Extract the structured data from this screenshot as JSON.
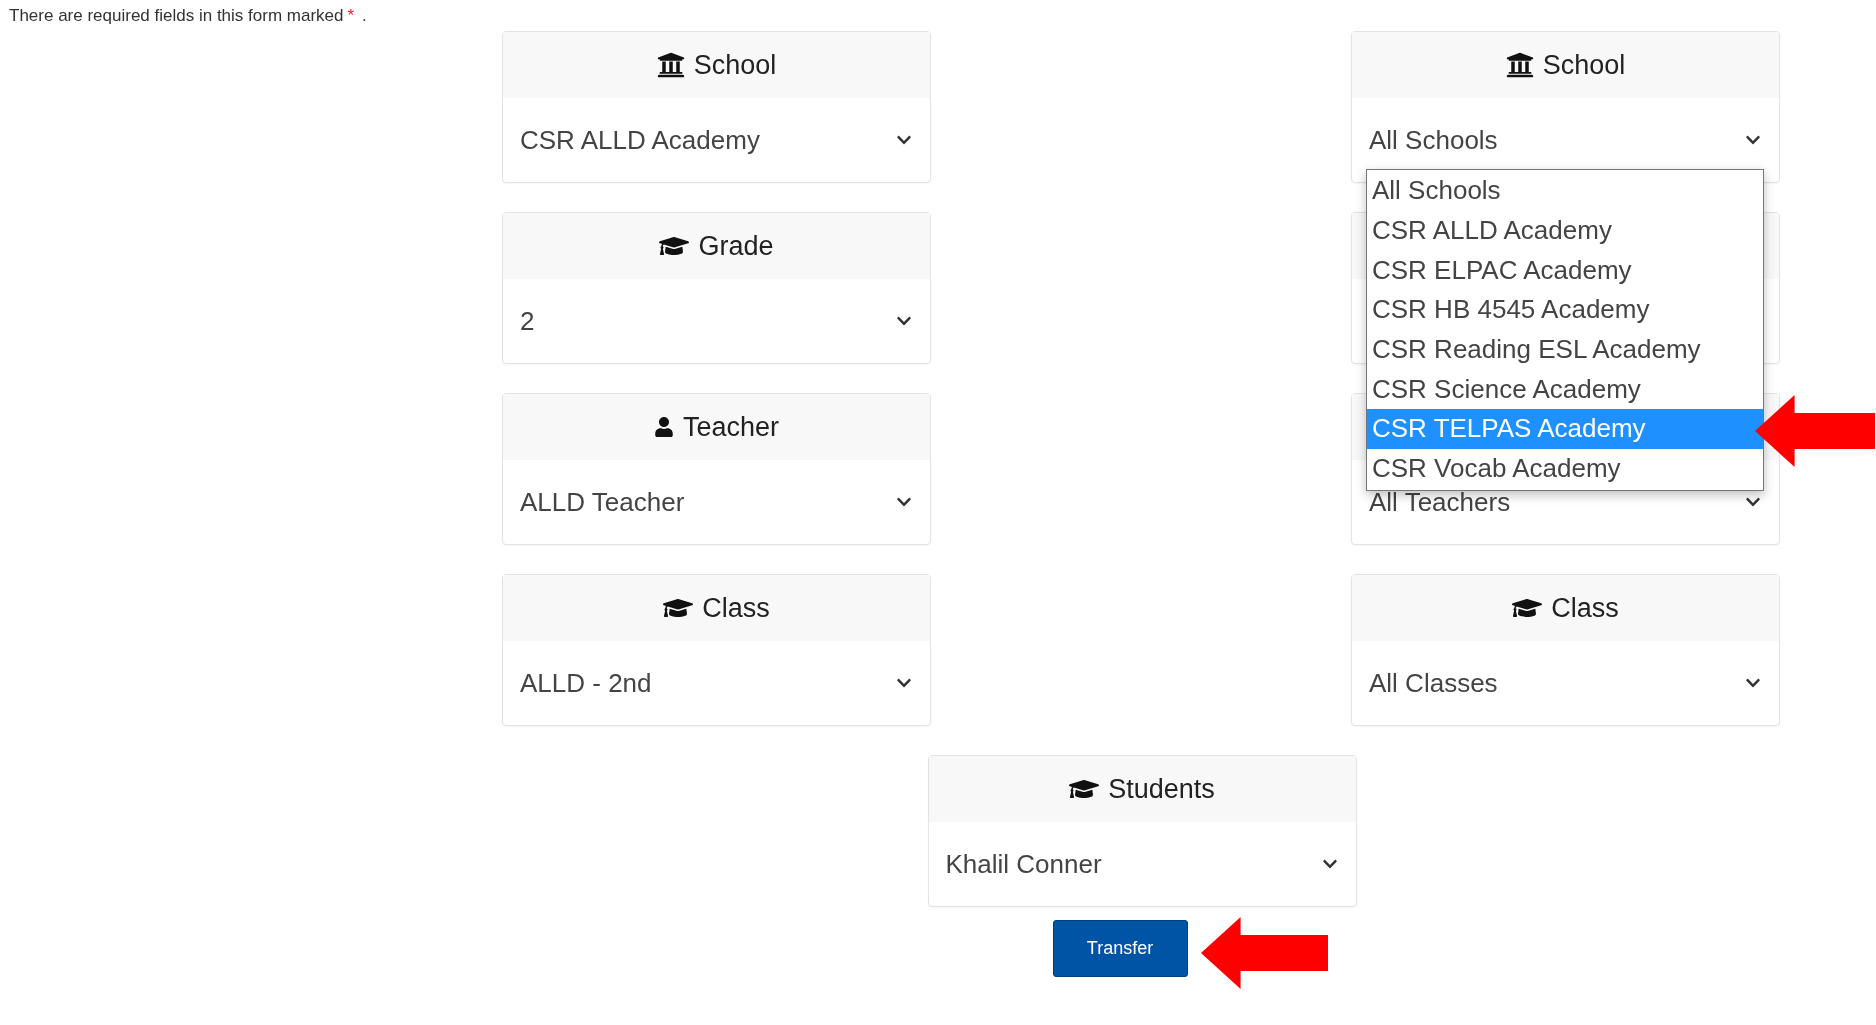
{
  "notice": {
    "text": "There are required fields in this form marked",
    "required_mark": "*",
    "end": "."
  },
  "left_column": [
    {
      "kind": "building",
      "title": "School",
      "value": "CSR ALLD Academy"
    },
    {
      "kind": "cap",
      "title": "Grade",
      "value": "2"
    },
    {
      "kind": "person",
      "title": "Teacher",
      "value": "ALLD Teacher"
    },
    {
      "kind": "cap",
      "title": "Class",
      "value": "ALLD - 2nd"
    }
  ],
  "right_column": [
    {
      "kind": "building",
      "title": "School",
      "value": "All Schools",
      "open_list": {
        "options": [
          {
            "label": "All Schools",
            "selected": false
          },
          {
            "label": "CSR ALLD Academy",
            "selected": false
          },
          {
            "label": "CSR ELPAC Academy",
            "selected": false
          },
          {
            "label": "CSR HB 4545 Academy",
            "selected": false
          },
          {
            "label": "CSR Reading ESL Academy",
            "selected": false
          },
          {
            "label": "CSR Science Academy",
            "selected": false
          },
          {
            "label": "CSR TELPAS Academy",
            "selected": true
          },
          {
            "label": "CSR Vocab Academy",
            "selected": false
          }
        ]
      }
    },
    {
      "kind": "blank"
    },
    {
      "value": "All Teachers"
    },
    {
      "kind": "cap",
      "title": "Class",
      "value": "All Classes"
    }
  ],
  "students": {
    "kind": "cap",
    "title": "Students",
    "value": "Khalil Conner"
  },
  "transfer_button": {
    "label": "Transfer"
  }
}
